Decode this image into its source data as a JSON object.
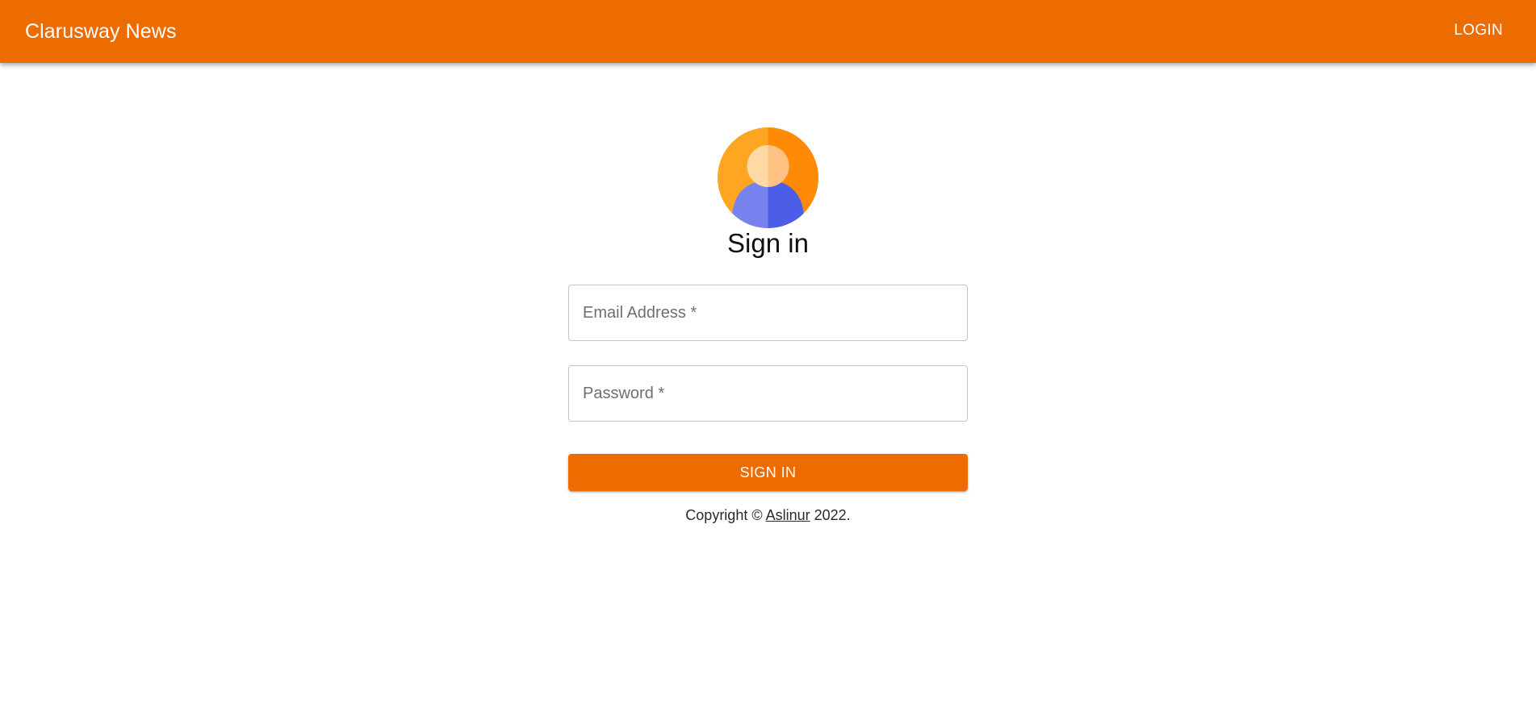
{
  "appbar": {
    "brand": "Clarusway News",
    "login_label": "LOGIN",
    "color": "#ed6c02"
  },
  "signin": {
    "avatar_icon": "user-avatar-icon",
    "title": "Sign in",
    "email_placeholder": "Email Address *",
    "email_value": "",
    "password_placeholder": "Password *",
    "password_value": "",
    "button_label": "SIGN IN"
  },
  "footer": {
    "prefix": "Copyright © ",
    "author": "Aslinur",
    "suffix": " 2022."
  }
}
